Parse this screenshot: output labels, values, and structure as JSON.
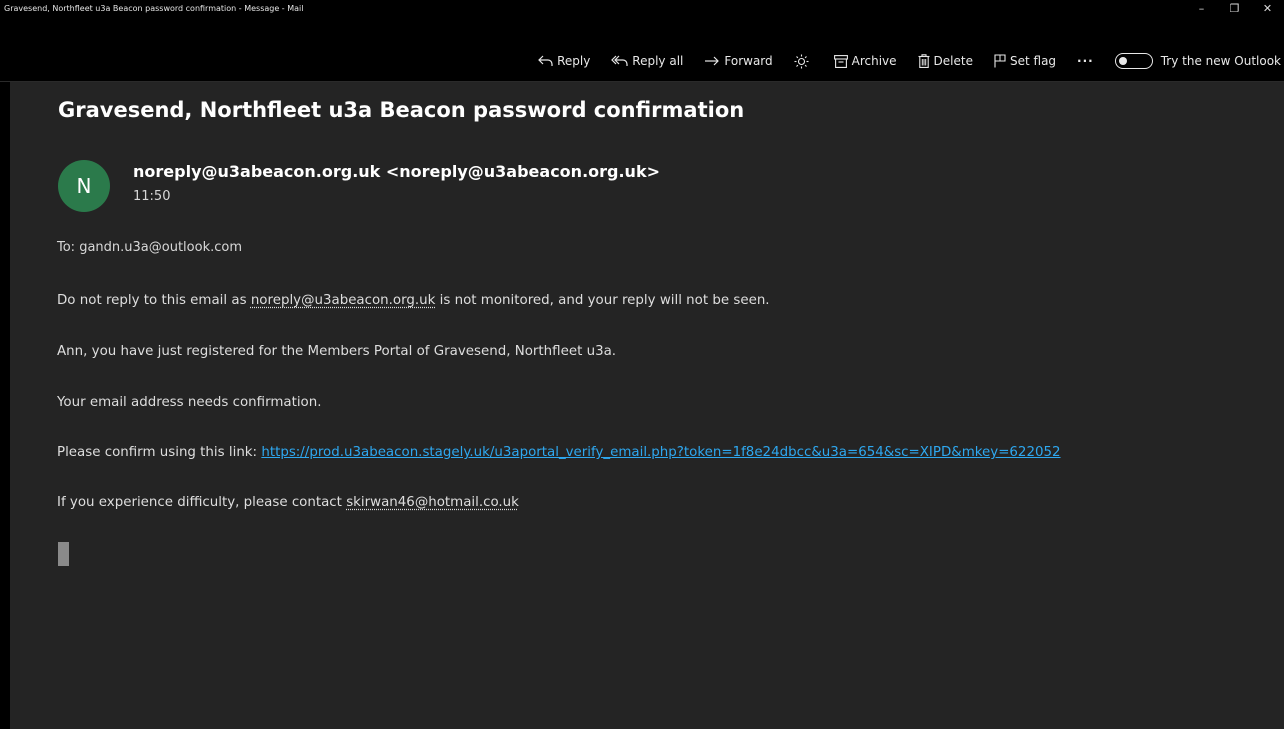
{
  "window": {
    "title": "Gravesend, Northfleet u3a Beacon password confirmation - Message - Mail",
    "controls": {
      "minimize": "–",
      "restore": "❐",
      "close": "✕"
    }
  },
  "toolbar": {
    "reply": "Reply",
    "reply_all": "Reply all",
    "forward": "Forward",
    "archive": "Archive",
    "delete": "Delete",
    "set_flag": "Set flag",
    "more": "···",
    "try_new_outlook": "Try the new Outlook"
  },
  "message": {
    "subject": "Gravesend, Northfleet u3a Beacon password confirmation",
    "avatar_initial": "N",
    "avatar_color": "#2b7a4b",
    "sender": "noreply@u3abeacon.org.uk <noreply@u3abeacon.org.uk>",
    "time": "11:50",
    "to_label": "To: ",
    "to_address": "gandn.u3a@outlook.com",
    "body": {
      "p1_pre": "Do not reply to this email as ",
      "p1_email": "noreply@u3abeacon.org.uk",
      "p1_post": " is not monitored, and your reply will not be seen.",
      "p2": "Ann, you have just registered for the Members Portal of Gravesend, Northfleet u3a.",
      "p3": "Your email address needs confirmation.",
      "p4_pre": "Please confirm using this link: ",
      "p4_link": "https://prod.u3abeacon.stagely.uk/u3aportal_verify_email.php?token=1f8e24dbcc&u3a=654&sc=XIPD&mkey=622052",
      "p5_pre": "If you experience difficulty, please contact ",
      "p5_email": "skirwan46@hotmail.co.uk"
    }
  },
  "colors": {
    "window_bg": "#000000",
    "pane_bg": "#242424",
    "link": "#2ea8f0"
  }
}
